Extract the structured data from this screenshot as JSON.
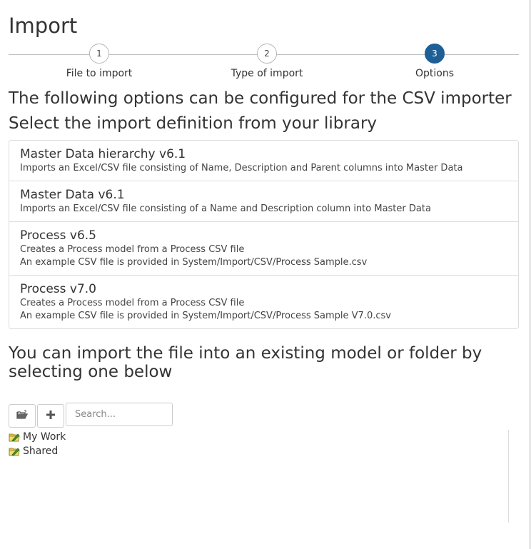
{
  "page_title": "Import",
  "steps": [
    {
      "number": "1",
      "label": "File to import"
    },
    {
      "number": "2",
      "label": "Type of import"
    },
    {
      "number": "3",
      "label": "Options"
    }
  ],
  "active_step": 3,
  "options_heading": "The following options can be configured for the CSV importer",
  "library_heading": "Select the import definition from your library",
  "definitions": [
    {
      "name": "Master Data hierarchy v6.1",
      "desc": [
        "Imports an Excel/CSV file consisting of Name, Description and Parent columns into Master Data"
      ]
    },
    {
      "name": "Master Data v6.1",
      "desc": [
        "Imports an Excel/CSV file consisting of a Name and Description column into Master Data"
      ]
    },
    {
      "name": "Process v6.5",
      "desc": [
        "Creates a Process model from a Process CSV file",
        "An example CSV file is provided in System/Import/CSV/Process Sample.csv"
      ]
    },
    {
      "name": "Process v7.0",
      "desc": [
        "Creates a Process model from a Process CSV file",
        "An example CSV file is provided in System/Import/CSV/Process Sample V7.0.csv"
      ]
    }
  ],
  "target_heading": "You can import the file into an existing model or folder by selecting one below",
  "toolbar": {
    "open_folder_icon": "open-folder-icon",
    "add_icon": "plus-icon",
    "search_placeholder": "Search..."
  },
  "tree": [
    {
      "label": "My Work",
      "icon": "folder-edit-icon"
    },
    {
      "label": "Shared",
      "icon": "folder-edit-icon"
    }
  ],
  "colors": {
    "active_step": "#1e5f96",
    "border": "#dddddd",
    "text": "#333333"
  }
}
